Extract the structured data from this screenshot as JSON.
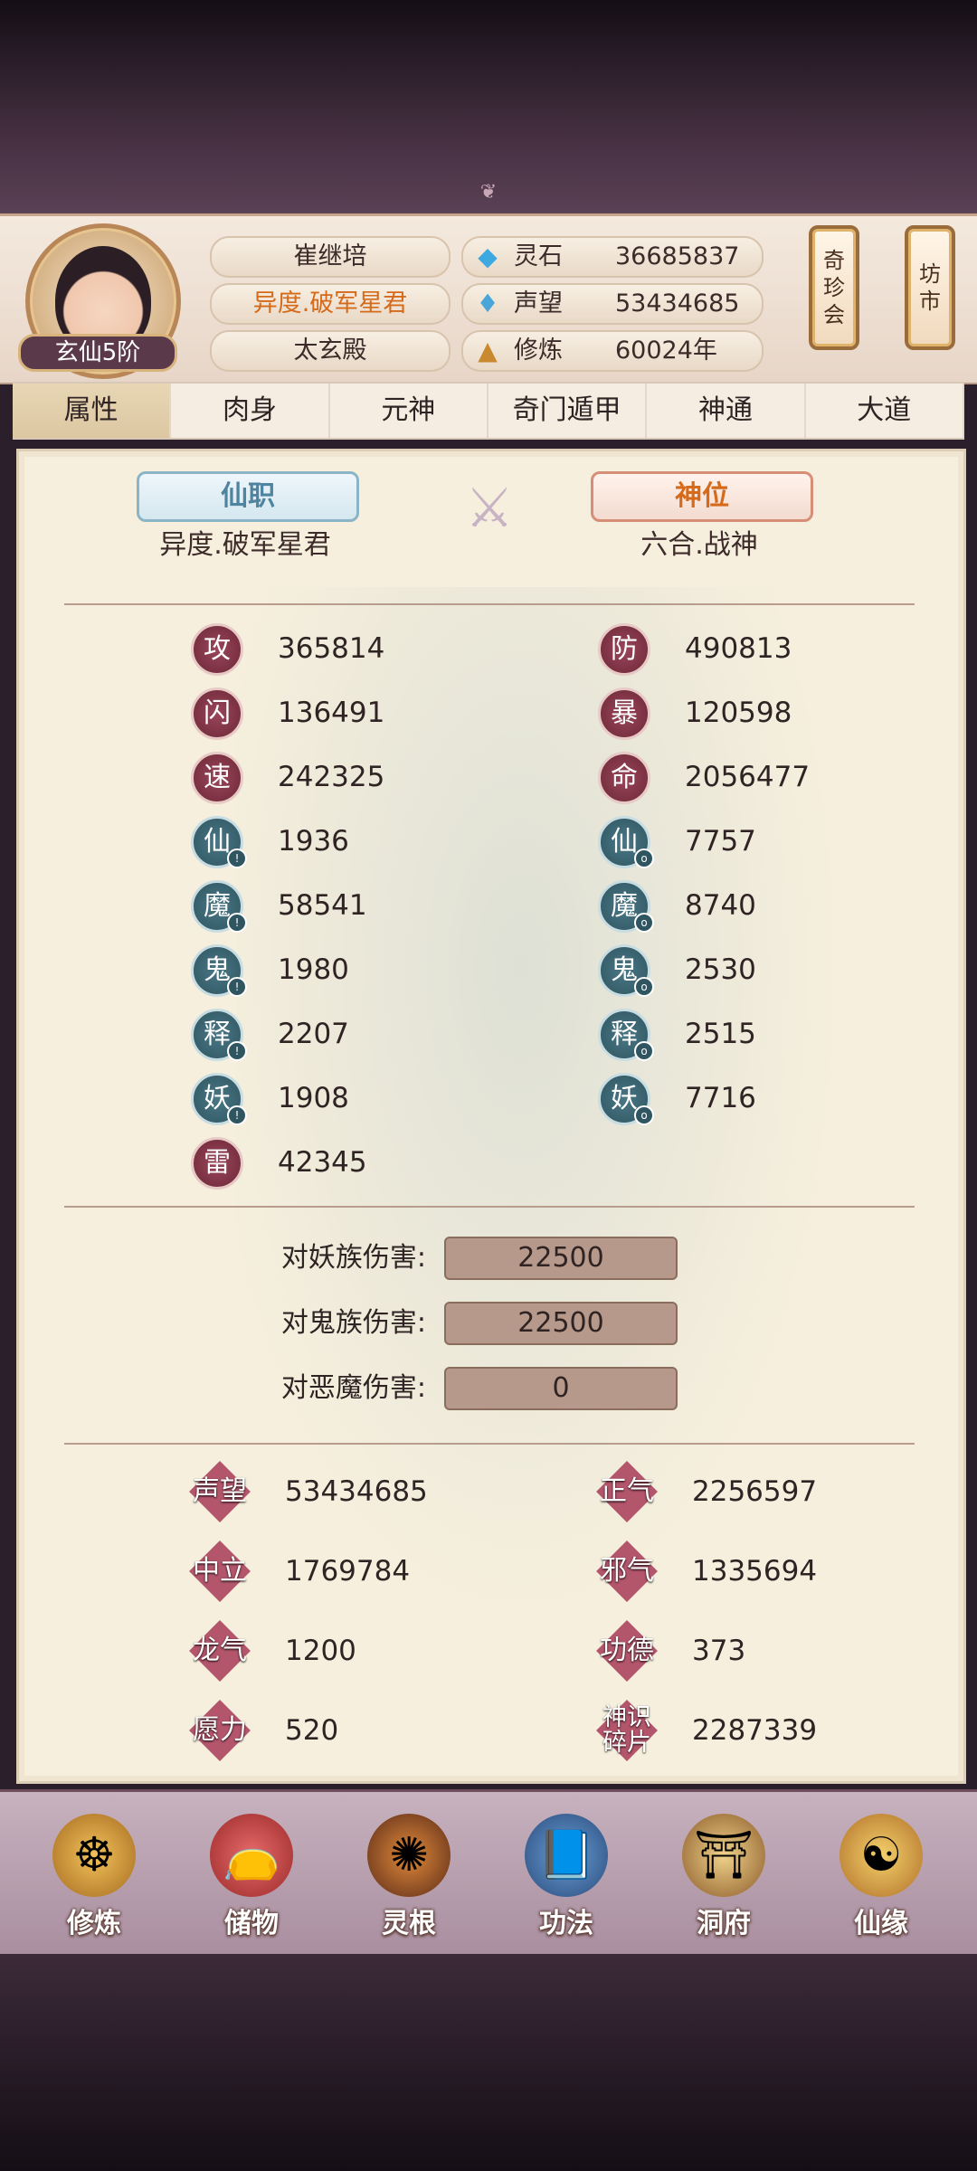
{
  "header": {
    "avatar_rank": "玄仙5阶",
    "names": [
      "崔继培",
      "异度.破军星君",
      "太玄殿"
    ],
    "resources": [
      {
        "icon": "spirit-stone-icon",
        "label": "灵石",
        "value": "36685837"
      },
      {
        "icon": "prestige-drop-icon",
        "label": "声望",
        "value": "53434685"
      },
      {
        "icon": "meditation-icon",
        "label": "修炼",
        "value": "60024年"
      }
    ],
    "buttons": {
      "treasure": "奇\n珍\n会",
      "market": "坊\n市"
    }
  },
  "tabs": [
    "属性",
    "肉身",
    "元神",
    "奇门遁甲",
    "神通",
    "大道"
  ],
  "active_tab": "属性",
  "ranks": {
    "left_title": "仙职",
    "left_value": "异度.破军星君",
    "right_title": "神位",
    "right_value": "六合.战神"
  },
  "stats_left": [
    {
      "badge": "攻",
      "value": "365814"
    },
    {
      "badge": "闪",
      "value": "136491"
    },
    {
      "badge": "速",
      "value": "242325"
    },
    {
      "badge": "仙",
      "value": "1936"
    },
    {
      "badge": "魔",
      "value": "58541"
    },
    {
      "badge": "鬼",
      "value": "1980"
    },
    {
      "badge": "释",
      "value": "2207"
    },
    {
      "badge": "妖",
      "value": "1908"
    },
    {
      "badge": "雷",
      "value": "42345"
    }
  ],
  "stats_right": [
    {
      "badge": "防",
      "value": "490813"
    },
    {
      "badge": "暴",
      "value": "120598"
    },
    {
      "badge": "命",
      "value": "2056477"
    },
    {
      "badge": "仙",
      "value": "7757"
    },
    {
      "badge": "魔",
      "value": "8740"
    },
    {
      "badge": "鬼",
      "value": "2530"
    },
    {
      "badge": "释",
      "value": "2515"
    },
    {
      "badge": "妖",
      "value": "7716"
    }
  ],
  "damage": [
    {
      "label": "对妖族伤害:",
      "value": "22500"
    },
    {
      "label": "对鬼族伤害:",
      "value": "22500"
    },
    {
      "label": "对恶魔伤害:",
      "value": "0"
    }
  ],
  "extras_left": [
    {
      "badge": "声望",
      "value": "53434685"
    },
    {
      "badge": "中立",
      "value": "1769784"
    },
    {
      "badge": "龙气",
      "value": "1200"
    },
    {
      "badge": "愿力",
      "value": "520"
    }
  ],
  "extras_right": [
    {
      "badge": "正气",
      "value": "2256597"
    },
    {
      "badge": "邪气",
      "value": "1335694"
    },
    {
      "badge": "功德",
      "value": "373"
    },
    {
      "badge": "神识\n碎片",
      "value": "2287339"
    }
  ],
  "bottom_nav": [
    {
      "icon": "monk-icon",
      "label": "修炼"
    },
    {
      "icon": "treasure-bag-icon",
      "label": "储物"
    },
    {
      "icon": "spirit-root-icon",
      "label": "灵根"
    },
    {
      "icon": "scripture-book-icon",
      "label": "功法"
    },
    {
      "icon": "cave-palace-icon",
      "label": "洞府"
    },
    {
      "icon": "gourd-icon",
      "label": "仙缘"
    }
  ],
  "colors": {
    "active_tab": "#dcc7a2",
    "badge_red": "#8a3a4d",
    "badge_teal": "#3d6a77",
    "gold_text": "#d56a1a"
  }
}
